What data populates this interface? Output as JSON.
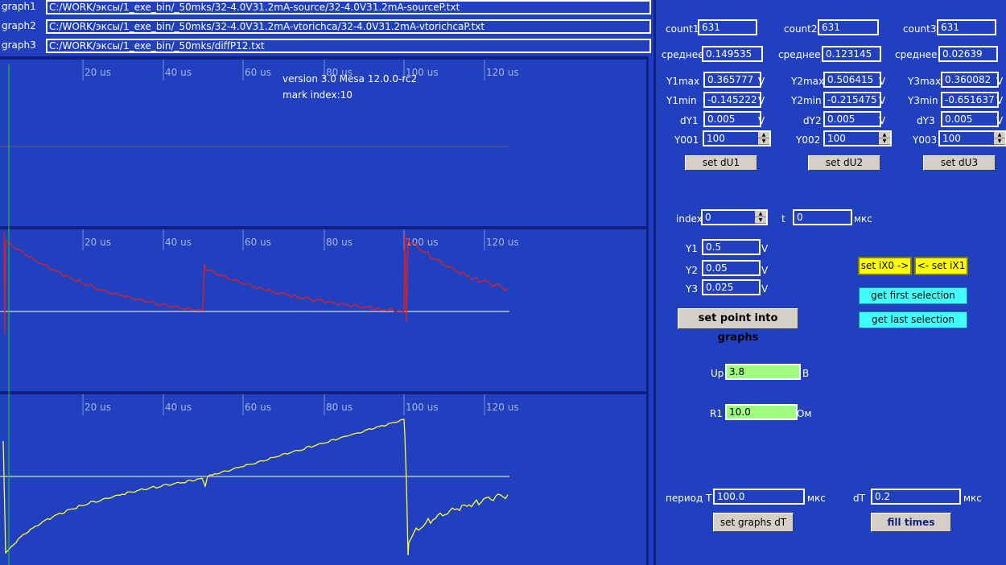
{
  "files": [
    {
      "label": "graph1",
      "path": "C:/WORK/эксы/1_exe_bin/_50mks/32-4.0V31.2mA-source/32-4.0V31.2mA-sourceP.txt"
    },
    {
      "label": "graph2",
      "path": "C:/WORK/эксы/1_exe_bin/_50mks/32-4.0V31.2mA-vtorichca/32-4.0V31.2mA-vtorichcaP.txt"
    },
    {
      "label": "graph3",
      "path": "C:/WORK/эксы/1_exe_bin/_50mks/diffP12.txt"
    }
  ],
  "plot": {
    "version_text": "version 3.0 Mesa 12.0.0-rc2",
    "mark_text": "mark index:10",
    "ticks": [
      "20 us",
      "40 us",
      "60 us",
      "80 us",
      "100 us",
      "120 us"
    ],
    "colors": {
      "g1": "#20d020",
      "g2": "#e02020",
      "g3": "#ffff20",
      "baseline": "#ffffc0",
      "bg": "#2040c0"
    }
  },
  "stats": [
    {
      "count_label": "count1",
      "count": "631",
      "mean_label": "среднее",
      "mean": "0.149535",
      "max_label": "Y1max",
      "max": "0.365777",
      "min_label": "Y1min",
      "min": "-0.145222",
      "dy_label": "dY1",
      "dy": "0.005",
      "y0_label": "Y001",
      "y0": "100",
      "unit": "V",
      "button": "set dU1"
    },
    {
      "count_label": "count2",
      "count": "631",
      "mean_label": "среднее",
      "mean": "0.123145",
      "max_label": "Y2max",
      "max": "0.506415",
      "min_label": "Y2min",
      "min": "-0.215475",
      "dy_label": "dY2",
      "dy": "0.005",
      "y0_label": "Y002",
      "y0": "100",
      "unit": "V",
      "button": "set dU2"
    },
    {
      "count_label": "count3",
      "count": "631",
      "mean_label": "среднее",
      "mean": "0.02639",
      "max_label": "Y3max",
      "max": "0.360082",
      "min_label": "Y3min",
      "min": "-0.651637",
      "dy_label": "dY3",
      "dy": "0.005",
      "y0_label": "Y003",
      "y0": "100",
      "unit": "V",
      "button": "set dU3"
    }
  ],
  "index": {
    "label": "index",
    "value": "0",
    "t_label": "t",
    "t_value": "0",
    "t_unit": "мкс"
  },
  "y": {
    "y1_label": "Y1",
    "y1": "0.5",
    "y2_label": "Y2",
    "y2": "0.05",
    "y3_label": "Y3",
    "y3": "0.025",
    "unit": "V",
    "set_point_button": "set point into graphs"
  },
  "selection": {
    "set_ix0": "set iX0 ->",
    "set_ix1": "<- set iX1",
    "get_first": "get first selection",
    "get_last": "get last selection"
  },
  "params": {
    "up_label": "Up",
    "up": "3.8",
    "up_unit": "В",
    "r1_label": "R1",
    "r1": "10.0",
    "r1_unit": "Ом"
  },
  "period": {
    "label": "период T",
    "value": "100.0",
    "unit": "мкс",
    "dt_label": "dT",
    "dt": "0.2",
    "dt_unit": "мкс",
    "set_dt_button": "set graphs dT",
    "fill_button": "fill times"
  }
}
